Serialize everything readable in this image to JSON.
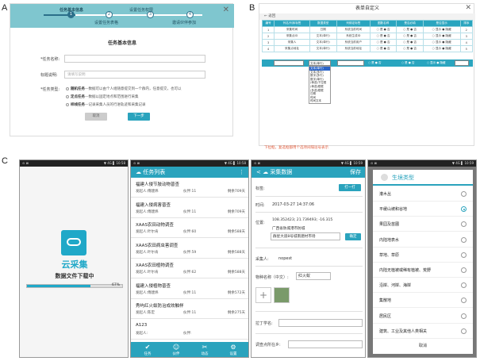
{
  "labels": {
    "a": "A",
    "b": "B",
    "c": "C"
  },
  "panelA": {
    "steps": [
      "任务基本信息",
      "设置任务权限",
      "设置任务表格",
      "邀请伙伴参加"
    ],
    "step_nums": [
      "1",
      "2",
      "3",
      "4"
    ],
    "form_title": "任务基本信息",
    "name_label": "*任务名称:",
    "desc_label": "标题说明:",
    "desc_placeholder": "请填写说明",
    "type_label": "*任务类型:",
    "opt1_title": "随机任务",
    "opt1_desc": "—数据可以由个人组随意提交到一个群内，任意提交，也可以",
    "opt2_title": "定点任务",
    "opt2_desc": "—数据以固定地点和范围进行采集",
    "opt3_title": "样线任务",
    "opt3_desc": "—记录采集人员的行进轨迹和采集记录",
    "btn_cancel": "取消",
    "btn_next": "下一步",
    "close": "✕"
  },
  "panelB": {
    "title": "表单自定义",
    "close": "✕",
    "back": "← 返回",
    "headers": [
      "编号",
      "列名/列序标签",
      "数据类型",
      "列绑定标签",
      "图数名称",
      "是否必填",
      "是否显示",
      "排序"
    ],
    "rows": [
      [
        "1",
        "采集时间",
        "日期",
        "系统当前时间",
        "○ 是 ● 否",
        "○ 是 ● 否",
        "○ 显示 ● 隐藏",
        "2"
      ],
      [
        "2",
        "采集点ID",
        "文本(单行)",
        "系统生成ID",
        "○ 是 ● 否",
        "○ 是 ● 否",
        "○ 显示 ● 隐藏",
        "3"
      ],
      [
        "3",
        "采集人",
        "文本(单行)",
        "系统当前用户",
        "○ 是 ● 否",
        "○ 是 ● 否",
        "○ 显示 ● 隐藏",
        "4"
      ],
      [
        "4",
        "采集点地址",
        "文本(单行)",
        "系统当前地址",
        "○ 是 ● 否",
        "○ 是 ● 否",
        "○ 显示 ● 隐藏",
        "5"
      ]
    ],
    "add_select": "文本(单行)",
    "add_radio1": "○ 是 ● 否",
    "add_radio2": "○ 显示 ● 隐藏",
    "add_num": "",
    "dropdown": [
      "文本(单行)",
      "文本(多行)",
      "数字(多行)",
      "数字(单行)",
      "(单选)下拉框",
      "(单选)框框",
      "(多选)框框",
      "日期",
      "时间",
      "时间文本"
    ],
    "hint": "下拉框，复选框都用个选项间隔逗号表示"
  },
  "phone1": {
    "status_left": "⊙ ⊠",
    "status_right": "▼ 4G ▌ 10:58",
    "app_name": "云采集",
    "download": "数据文件下载中",
    "progress": 67,
    "progress_label": "67%"
  },
  "phone2": {
    "status_left": "⊙ ⊠",
    "status_right": "▼ 4G ▌ 10:58",
    "title": "任务列表",
    "menu": "⋮",
    "tasks": [
      {
        "name": "福建人侵节肢动物普查",
        "who": "发起人:傅建炜",
        "mates": "伙伴:11",
        "left": "剩余709天"
      },
      {
        "name": "福建入侵病害普查",
        "who": "发起人:傅建炜",
        "mates": "伙伴:11",
        "left": "剩余709天"
      },
      {
        "name": "XAAS农田动物调查",
        "who": "发起人:叶尔肯",
        "mates": "伙伴:60",
        "left": "剩余588天"
      },
      {
        "name": "XAAS农田病虫害调查",
        "who": "发起人:叶尔肯",
        "mates": "伙伴:59",
        "left": "剩余588天"
      },
      {
        "name": "XAAS农田植物调查",
        "who": "发起人:叶尔肯",
        "mates": "伙伴:62",
        "left": "剩余588天"
      },
      {
        "name": "福建入侵植物普查",
        "who": "发起人:傅建炜",
        "mates": "伙伴:11",
        "left": "剩余572天"
      },
      {
        "name": "秀屿红火蚁防治成效触样",
        "who": "发起人:陈宏",
        "mates": "伙伴:11",
        "left": "剩余275天"
      },
      {
        "name": "A123",
        "who": "发起人:",
        "mates": "伙伴:",
        "left": ""
      }
    ],
    "nav": [
      {
        "icon": "✔",
        "label": "任务"
      },
      {
        "icon": "☺",
        "label": "伙伴"
      },
      {
        "icon": "✂",
        "label": "动态"
      },
      {
        "icon": "⚙",
        "label": "设置"
      }
    ]
  },
  "phone3": {
    "status_left": "⊙ ⊠",
    "status_right": "▼ 4G ▌ 10:59",
    "title": "采集数据",
    "back": "<",
    "save": "保存",
    "tag_label": "标签:",
    "tag_btn": "打一打",
    "time_label": "时间:",
    "time_value": "2017-03-27 14:37:06",
    "loc_label": "位置:",
    "loc_coords": "108.352423; 21.739493; -16.315",
    "loc_addr1": "广西省防城港市防城",
    "loc_addr2": "群星大道8号城南建材市场",
    "loc_btn": "确定",
    "collector_label": "采集人:",
    "collector_value": "nopest",
    "species_label": "物种名称（中文）:",
    "species_value": "红火蚁",
    "latin_label": "拉丁学名:",
    "site_label": "调查点所在乡:",
    "add": "+"
  },
  "phone4": {
    "status_left": "⊙ ⊠",
    "status_right": "▼ 4G ▌ 10:59",
    "title": "生境类型",
    "options": [
      "灌木丛",
      "平缓山坡和谷地",
      "果园及苗圃",
      "内陆地表水",
      "草地、草原",
      "内陆无植被或稀有植被、荒野",
      "沿岸、河岸、海岸",
      "集散地",
      "居民区",
      "建筑、工业及其他人类相关"
    ],
    "selected_index": 1,
    "cancel": "取消"
  }
}
